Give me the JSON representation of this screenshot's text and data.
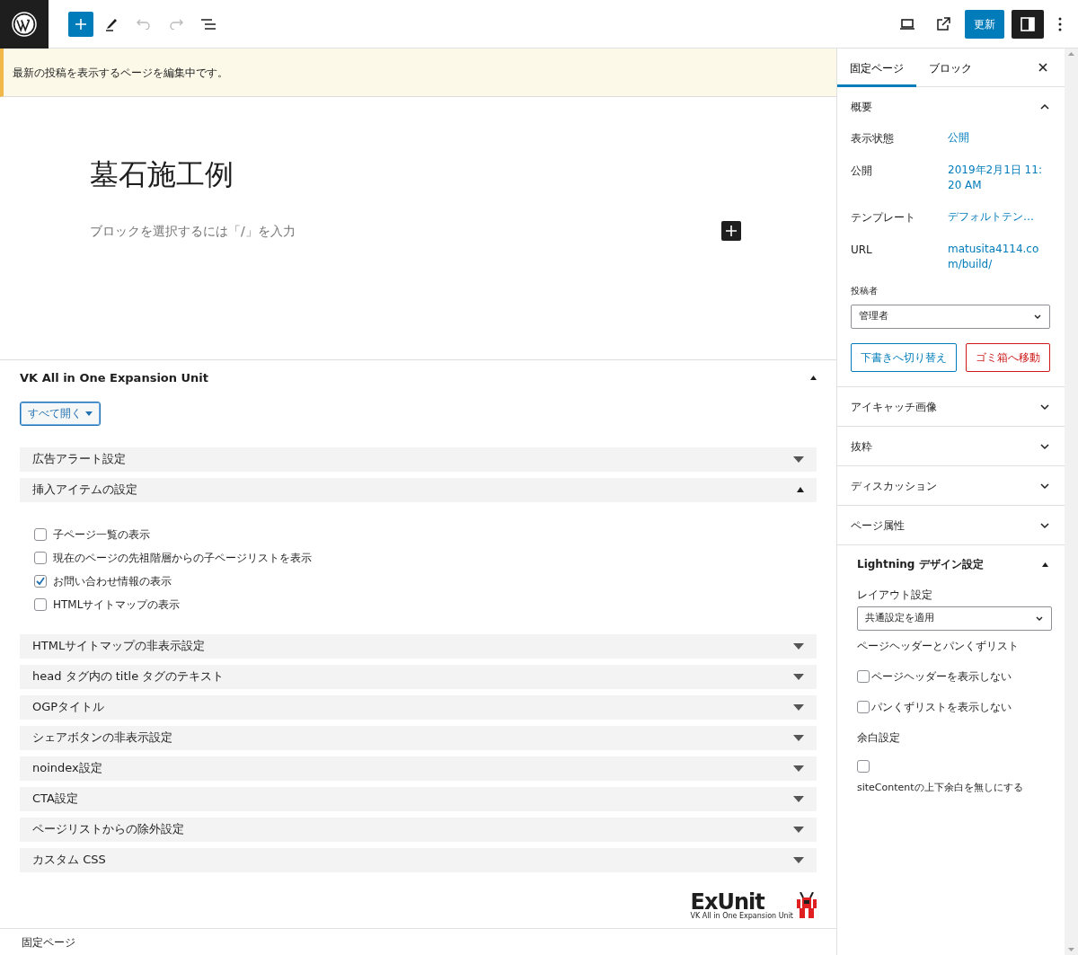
{
  "toolbar": {
    "add_selected": true,
    "undo_disabled": true,
    "redo_disabled": true,
    "update_button": "更新",
    "sidebar_toggle_on": true
  },
  "notice": "最新の投稿を表示するページを編集中です。",
  "editor": {
    "title": "墓石施工例",
    "placeholder": "ブロックを選択するには「/」を入力"
  },
  "metabox": {
    "title": "VK All in One Expansion Unit",
    "expanded": true,
    "open_all_button": "すべて開く",
    "sections": [
      {
        "label": "広告アラート設定",
        "expanded": false
      },
      {
        "label": "挿入アイテムの設定",
        "expanded": true,
        "options": [
          {
            "label": "子ページ一覧の表示",
            "checked": false
          },
          {
            "label": "現在のページの先祖階層からの子ページリストを表示",
            "checked": false
          },
          {
            "label": "お問い合わせ情報の表示",
            "checked": true
          },
          {
            "label": "HTMLサイトマップの表示",
            "checked": false
          }
        ]
      },
      {
        "label": "HTMLサイトマップの非表示設定",
        "expanded": false
      },
      {
        "label": "head タグ内の title タグのテキスト",
        "expanded": false
      },
      {
        "label": "OGPタイトル",
        "expanded": false
      },
      {
        "label": "シェアボタンの非表示設定",
        "expanded": false
      },
      {
        "label": "noindex設定",
        "expanded": false
      },
      {
        "label": "CTA設定",
        "expanded": false
      },
      {
        "label": "ページリストからの除外設定",
        "expanded": false
      },
      {
        "label": "カスタム CSS",
        "expanded": false
      }
    ],
    "logo": {
      "name": "ExUnit",
      "subtitle": "VK All in One Expansion Unit"
    }
  },
  "breadcrumb": "固定ページ",
  "sidebar": {
    "tabs": [
      {
        "label": "固定ページ",
        "selected": true
      },
      {
        "label": "ブロック",
        "selected": false
      }
    ],
    "summary": {
      "title": "概要",
      "expanded": true,
      "rows": [
        {
          "label": "表示状態",
          "value": "公開"
        },
        {
          "label": "公開",
          "value": "2019年2月1日 11:20 AM"
        },
        {
          "label": "テンプレート",
          "value": "デフォルトテン…"
        },
        {
          "label": "URL",
          "value": "matusita4114.com/build/"
        }
      ],
      "author_label": "投稿者",
      "author_value": "管理者",
      "draft_button": "下書きへ切り替え",
      "trash_button": "ゴミ箱へ移動"
    },
    "panels": [
      {
        "title": "アイキャッチ画像",
        "expanded": false
      },
      {
        "title": "抜粋",
        "expanded": false
      },
      {
        "title": "ディスカッション",
        "expanded": false
      },
      {
        "title": "ページ属性",
        "expanded": false
      }
    ],
    "lightning": {
      "title": "Lightning デザイン設定",
      "expanded": true,
      "layout_label": "レイアウト設定",
      "layout_value": "共通設定を適用",
      "header_label": "ページヘッダーとパンくずリスト",
      "header_options": [
        {
          "label": "ページヘッダーを表示しない",
          "checked": false
        },
        {
          "label": "パンくずリストを表示しない",
          "checked": false
        }
      ],
      "margin_label": "余白設定",
      "margin_option": {
        "label": "siteContentの上下余白を無しにする",
        "checked": false
      }
    }
  }
}
